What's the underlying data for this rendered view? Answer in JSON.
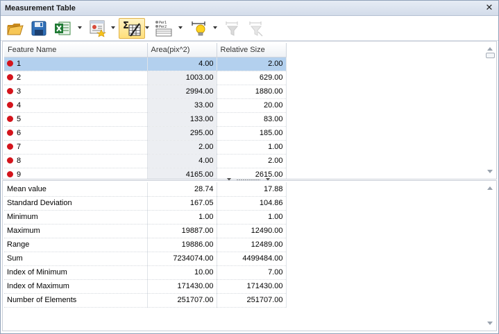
{
  "window": {
    "title": "Measurement Table",
    "close_glyph": "✕"
  },
  "toolbar": {
    "buttons": [
      {
        "name": "open-folder-icon"
      },
      {
        "name": "save-icon"
      },
      {
        "name": "excel-export-icon"
      },
      {
        "name": "report-icon"
      },
      {
        "name": "statistics-sigma-icon",
        "active": true
      },
      {
        "name": "per-feature-table-icon"
      },
      {
        "name": "highlight-bulb-icon"
      },
      {
        "name": "filter-icon",
        "disabled": true
      },
      {
        "name": "filter-clear-icon",
        "disabled": true
      }
    ]
  },
  "table": {
    "columns": [
      "Feature Name",
      "Area(pix^2)",
      "Relative Size"
    ],
    "rows": [
      {
        "name": "1",
        "area": "4.00",
        "size": "2.00",
        "selected": true
      },
      {
        "name": "2",
        "area": "1003.00",
        "size": "629.00"
      },
      {
        "name": "3",
        "area": "2994.00",
        "size": "1880.00"
      },
      {
        "name": "4",
        "area": "33.00",
        "size": "20.00"
      },
      {
        "name": "5",
        "area": "133.00",
        "size": "83.00"
      },
      {
        "name": "6",
        "area": "295.00",
        "size": "185.00"
      },
      {
        "name": "7",
        "area": "2.00",
        "size": "1.00"
      },
      {
        "name": "8",
        "area": "4.00",
        "size": "2.00"
      },
      {
        "name": "9",
        "area": "4165.00",
        "size": "2615.00"
      }
    ],
    "marker_color": "#d4141c"
  },
  "stats": [
    {
      "label": "Mean value",
      "area": "28.74",
      "size": "17.88"
    },
    {
      "label": "Standard Deviation",
      "area": "167.05",
      "size": "104.86"
    },
    {
      "label": "Minimum",
      "area": "1.00",
      "size": "1.00"
    },
    {
      "label": "Maximum",
      "area": "19887.00",
      "size": "12490.00"
    },
    {
      "label": "Range",
      "area": "19886.00",
      "size": "12489.00"
    },
    {
      "label": "Sum",
      "area": "7234074.00",
      "size": "4499484.00"
    },
    {
      "label": "Index of Minimum",
      "area": "10.00",
      "size": "7.00"
    },
    {
      "label": "Index of Maximum",
      "area": "171430.00",
      "size": "171430.00"
    },
    {
      "label": "Number of Elements",
      "area": "251707.00",
      "size": "251707.00"
    }
  ]
}
